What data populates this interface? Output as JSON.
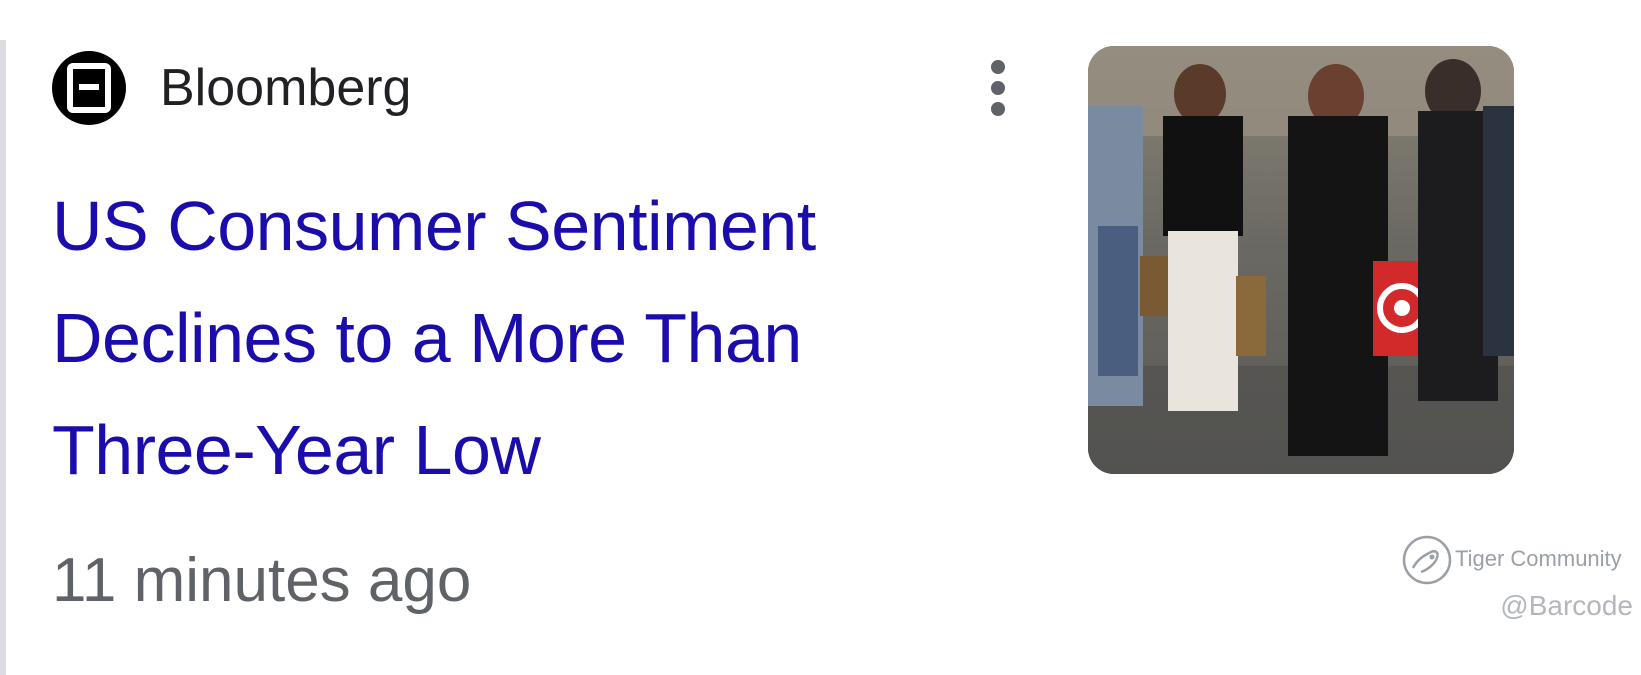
{
  "source": {
    "name": "Bloomberg",
    "logo_icon": "bloomberg-b-logo"
  },
  "menu": {
    "icon": "more-vert-icon"
  },
  "article": {
    "headline": "US Consumer Sentiment Declines to a More Than Three-Year Low",
    "timestamp": "11 minutes ago",
    "thumbnail_icon": "shoppers-photo"
  },
  "watermark": {
    "brand": "Tiger Community",
    "handle": "@Barcode"
  },
  "colors": {
    "headline": "#1a0dab",
    "source_text": "#202124",
    "meta_text": "#5f6368",
    "divider": "#dadce0"
  }
}
